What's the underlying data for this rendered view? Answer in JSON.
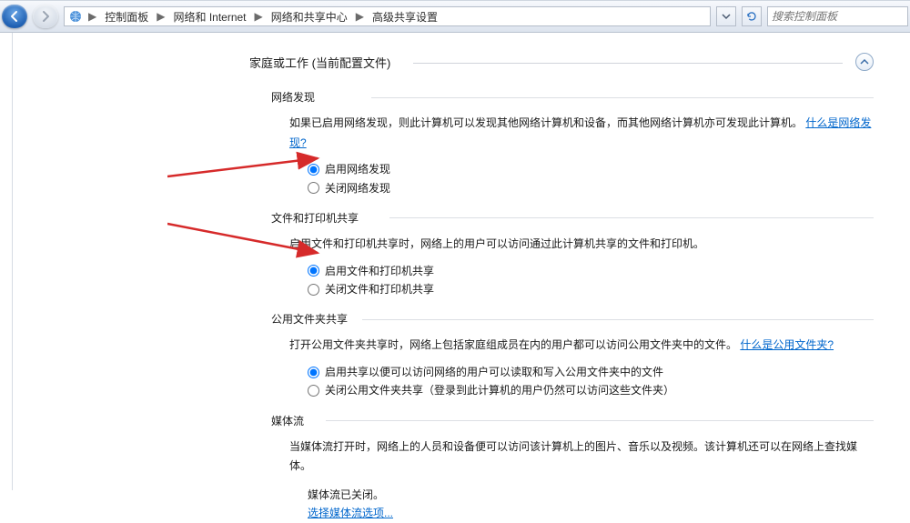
{
  "breadcrumb": {
    "items": [
      "控制面板",
      "网络和 Internet",
      "网络和共享中心",
      "高级共享设置"
    ]
  },
  "search": {
    "placeholder": "搜索控制面板"
  },
  "profile": {
    "title": "家庭或工作 (当前配置文件)"
  },
  "sections": {
    "discovery": {
      "title": "网络发现",
      "desc_before_link": "如果已启用网络发现，则此计算机可以发现其他网络计算机和设备，而其他网络计算机亦可发现此计算机。",
      "link": "什么是网络发现?",
      "opt_on": "启用网络发现",
      "opt_off": "关闭网络发现"
    },
    "file_printer": {
      "title": "文件和打印机共享",
      "desc": "启用文件和打印机共享时，网络上的用户可以访问通过此计算机共享的文件和打印机。",
      "opt_on": "启用文件和打印机共享",
      "opt_off": "关闭文件和打印机共享"
    },
    "public_folder": {
      "title": "公用文件夹共享",
      "desc_before_link": "打开公用文件夹共享时，网络上包括家庭组成员在内的用户都可以访问公用文件夹中的文件。",
      "link": "什么是公用文件夹?",
      "opt_on": "启用共享以便可以访问网络的用户可以读取和写入公用文件夹中的文件",
      "opt_off": "关闭公用文件夹共享（登录到此计算机的用户仍然可以访问这些文件夹）"
    },
    "media": {
      "title": "媒体流",
      "desc": "当媒体流打开时，网络上的人员和设备便可以访问该计算机上的图片、音乐以及视频。该计算机还可以在网络上查找媒体。",
      "status": "媒体流已关闭。",
      "link": "选择媒体流选项..."
    }
  }
}
